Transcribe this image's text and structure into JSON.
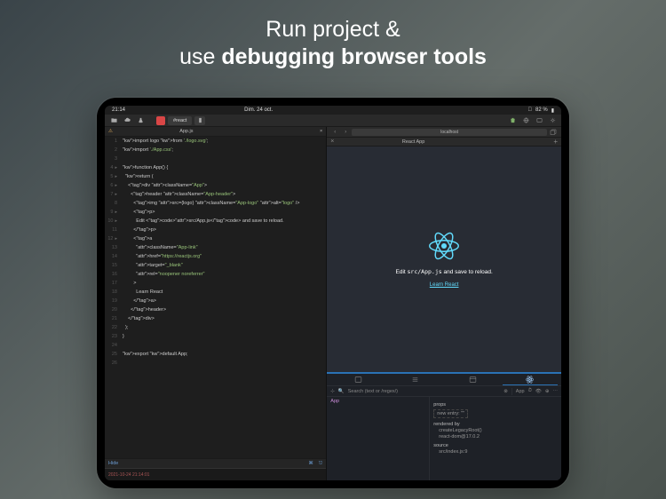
{
  "headline": {
    "line1": "Run project &",
    "line2_pre": "use ",
    "line2_bold": "debugging browser tools"
  },
  "status": {
    "time": "21:14",
    "date": "Dim. 24 oct.",
    "battery": "82 %",
    "wifi": "􀙇"
  },
  "toolbar": {
    "target": "#react"
  },
  "editor": {
    "filename": "App.js",
    "lines": [
      "import logo from './logo.svg';",
      "import './App.css';",
      "",
      "function App() {",
      "  return (",
      "    <div className=\"App\">",
      "      <header className=\"App-header\">",
      "        <img src={logo} className=\"App-logo\" alt=\"logo\" />",
      "        <p>",
      "          Edit <code>src/App.js</code> and save to reload.",
      "        </p>",
      "        <a",
      "          className=\"App-link\"",
      "          href=\"https://reactjs.org\"",
      "          target=\"_blank\"",
      "          rel=\"noopener noreferrer\"",
      "        >",
      "          Learn React",
      "        </a>",
      "      </header>",
      "    </div>",
      "  );",
      "}",
      "",
      "export default App;",
      ""
    ]
  },
  "footer": {
    "hide": "Hide",
    "middle": "⌘",
    "right": "⎋"
  },
  "console": {
    "timestamp": "2021-10-24 21:14:01"
  },
  "browser": {
    "address": "localhost",
    "tab_title": "React App",
    "preview_text_pre": "Edit ",
    "preview_text_code": "src/App.js",
    "preview_text_post": " and save to reload.",
    "preview_link": "Learn React"
  },
  "devtools": {
    "search_placeholder": "Search (text or /regex/)",
    "app_label": "App",
    "tree_root": "App",
    "props": {
      "heading": "props",
      "new_entry": "new entry: \"\"",
      "rendered_by": "rendered by",
      "rb1": "createLegacyRoot()",
      "rb2": "react-dom@17.0.2",
      "source": "source",
      "src_val": "src/index.js:9"
    }
  }
}
